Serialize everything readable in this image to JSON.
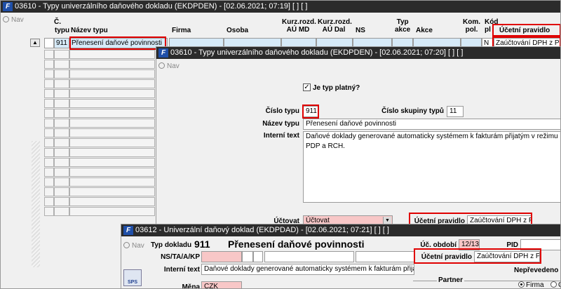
{
  "w1": {
    "title": "03610 - Typy univerzálního daňového dokladu (EKDPDEN) - [02.06.2021; 07:19] [ ] [ ]",
    "nav": "Nav",
    "headers": {
      "c": "Č.",
      "typu": "typu",
      "nazev": "Název typu",
      "firma": "Firma",
      "osoba": "Osoba",
      "kurz1a": "Kurz.rozd.",
      "kurz1b": "AÚ MD",
      "kurz2a": "Kurz.rozd.",
      "kurz2b": "AÚ Dal",
      "ns": "NS",
      "typ": "Typ",
      "akce_sub": "akce",
      "akce": "Akce",
      "kom1": "Kom.",
      "kom2": "pol.",
      "kod1": "Kód",
      "kod2": "pl",
      "ucetni": "Účetní pravidlo"
    },
    "row": {
      "cislo": "911",
      "nazev": "Přenesení daňové povinnosti",
      "kod": "N",
      "ucetni": "Zaúčtování DPH z PDP"
    }
  },
  "w2": {
    "title": "03610 - Typy univerzálního daňového dokladu (EKDPDEN) - [02.06.2021; 07:20] [ ] [ ]",
    "nav": "Nav",
    "je_platny": "Je typ platný?",
    "je_platny_check": "✓",
    "cislo_typu_label": "Číslo typu",
    "cislo_typu": "911",
    "cislo_skupiny_label": "Číslo skupiny typů",
    "cislo_skupiny": "11",
    "nazev_label": "Název typu",
    "nazev": "Přenesení daňové povinnosti",
    "interni_label": "Interní text",
    "interni": "Daňové doklady generované automaticky systémem k fakturám přijatým v režimu PDP a RCH.",
    "uctovat_label": "Účtovat",
    "uctovat": "Účtovat",
    "ucetni_label": "Účetní pravidlo",
    "ucetni": "Zaúčtování DPH z PDP"
  },
  "w3": {
    "title": "03612 - Univerzální daňový doklad (EKDPDAD) - [02.06.2021; 07:21] [ ] [ ]",
    "nav": "Nav",
    "typ_dokladu_label": "Typ dokladu",
    "typ_dokladu": "911",
    "typ_nazev": "Přenesení daňové povinnosti",
    "uc_obdobi_label": "Úč. období",
    "uc_obdobi": "12/13",
    "pid_label": "PID",
    "ns_label": "NS/TA/A/KP",
    "ucetni_label": "Účetní pravidlo",
    "ucetni": "Zaúčtování DPH z PDP",
    "interni_label": "Interní text",
    "interni": "Daňové doklady generované automaticky systémem k fakturám přijatým v rež",
    "neprevedeno": "Nepřevedeno",
    "mena_label": "Měna",
    "mena": "CZK",
    "partner_label": "Partner",
    "firma_radio": "Firma",
    "c_radio": "C",
    "sps": "SPS"
  },
  "colors": {
    "titlebar": "#2b2b2b",
    "highlight": "#e00000",
    "selected": "#d6eaf8",
    "required": "#f8c7c7"
  }
}
